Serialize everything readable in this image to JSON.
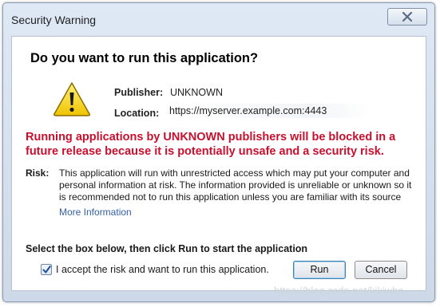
{
  "window": {
    "title": "Security Warning",
    "close_icon": "close-icon"
  },
  "dialog": {
    "heading": "Do you want to run this application?",
    "warning_icon": "warning-triangle-icon",
    "publisher_label": "Publisher:",
    "publisher_value": "UNKNOWN",
    "location_label": "Location:",
    "location_value": "https://myserver.example.com:4443",
    "block_warning": "Running applications by UNKNOWN publishers will be blocked in a future release because it is potentially unsafe and a security risk.",
    "risk_label": "Risk:",
    "risk_text": "This application will run with unrestricted access which may put your computer and personal information at risk. The information provided is unreliable or unknown so it is recommended not to run this application unless you are familiar with its source",
    "more_info_link": "More Information",
    "instruction": "Select the box below, then click Run to start the application",
    "accept_checkbox": {
      "checked": true,
      "label": "I accept the risk and want to run this application."
    },
    "run_button": "Run",
    "cancel_button": "Cancel"
  },
  "watermark": "https://blog.csdn.net/kikiwho",
  "colors": {
    "warning_red": "#c8102e",
    "link_blue": "#3361a6",
    "icon_yellow": "#f5d000"
  }
}
